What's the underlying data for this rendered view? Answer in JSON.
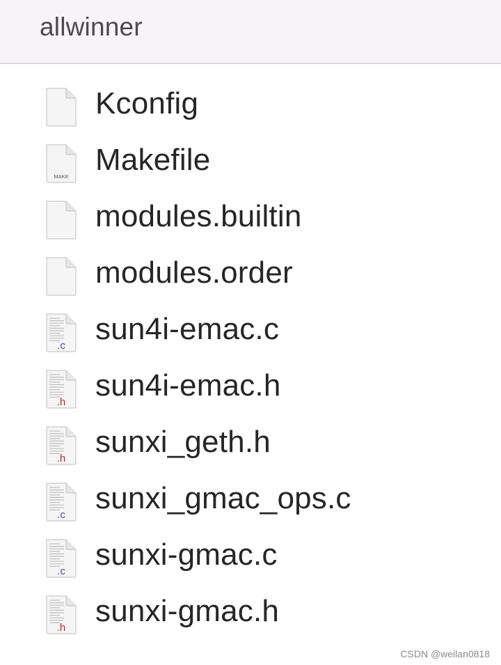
{
  "window": {
    "title": "allwinner"
  },
  "files": [
    {
      "name": "Kconfig",
      "icon": "blank-document-icon",
      "kind": "blank"
    },
    {
      "name": "Makefile",
      "icon": "makefile-document-icon",
      "kind": "make",
      "badge": "MAKE"
    },
    {
      "name": "modules.builtin",
      "icon": "blank-document-icon",
      "kind": "blank"
    },
    {
      "name": "modules.order",
      "icon": "blank-document-icon",
      "kind": "blank"
    },
    {
      "name": "sun4i-emac.c",
      "icon": "c-source-icon",
      "kind": "c",
      "badge": ".c"
    },
    {
      "name": "sun4i-emac.h",
      "icon": "h-header-icon",
      "kind": "h",
      "badge": ".h"
    },
    {
      "name": "sunxi_geth.h",
      "icon": "h-header-icon",
      "kind": "h",
      "badge": ".h"
    },
    {
      "name": "sunxi_gmac_ops.c",
      "icon": "c-source-icon",
      "kind": "c",
      "badge": ".c"
    },
    {
      "name": "sunxi-gmac.c",
      "icon": "c-source-icon",
      "kind": "c",
      "badge": ".c"
    },
    {
      "name": "sunxi-gmac.h",
      "icon": "h-header-icon",
      "kind": "h",
      "badge": ".h"
    }
  ],
  "watermark": "CSDN @weilan0818",
  "colors": {
    "c_badge": "#5b3fc4",
    "h_badge": "#c42a2a",
    "header_bg": "#f7f3f7"
  }
}
